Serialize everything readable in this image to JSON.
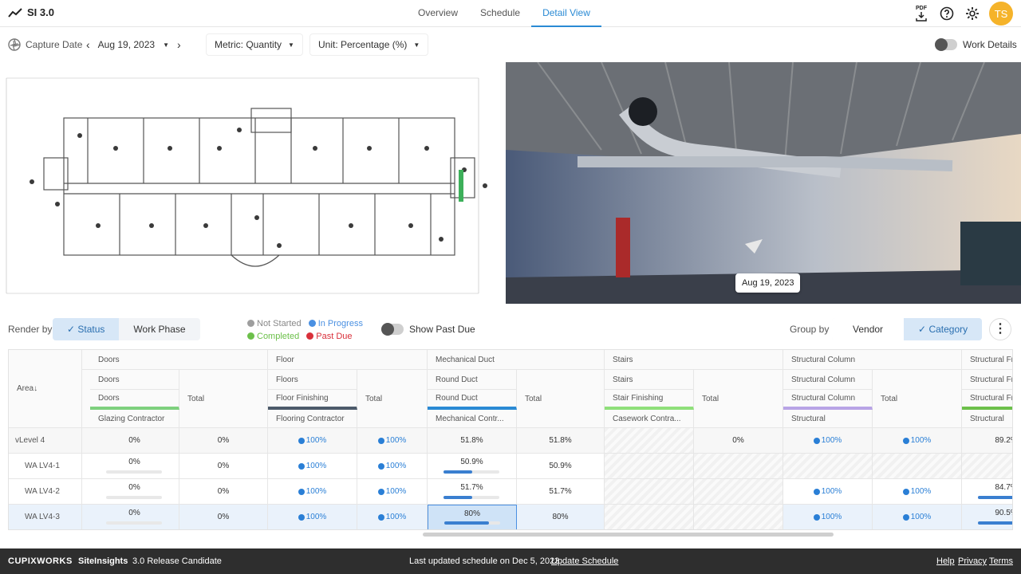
{
  "app": {
    "title": "SI 3.0"
  },
  "nav": {
    "tabs": [
      "Overview",
      "Schedule",
      "Detail View"
    ]
  },
  "header": {
    "pdf_label": "PDF",
    "user_initials": "TS"
  },
  "filters": {
    "capture_label": "Capture Date",
    "date": "Aug 19, 2023",
    "metric": "Metric: Quantity",
    "unit": "Unit: Percentage (%)",
    "work_details": "Work Details"
  },
  "viewer": {
    "date_label": "Aug 19, 2023"
  },
  "render": {
    "label": "Render by",
    "status": "Status",
    "work_phase": "Work Phase",
    "show_past_due": "Show Past Due",
    "group_by": "Group by",
    "vendor": "Vendor",
    "category": "Category"
  },
  "legend": {
    "not_started": "Not Started",
    "in_progress": "In Progress",
    "completed": "Completed",
    "past_due": "Past Due"
  },
  "colors": {
    "accent": "#2a8ad4",
    "not_started": "#9e9e9e",
    "in_progress": "#4a90e2",
    "completed": "#6cc04a",
    "past_due": "#d9303a",
    "avatar": "#f5b32a"
  },
  "table": {
    "area_header": "Area",
    "groups": [
      {
        "name": "Doors",
        "sub1": "Doors",
        "sub2": "Doors",
        "contractor": "Glazing Contractor",
        "bar": "#7ed07e"
      },
      {
        "name": "Floor",
        "sub1": "Floors",
        "sub2": "Floor Finishing",
        "contractor": "Flooring Contractor",
        "bar": "#4c5a6a"
      },
      {
        "name": "Mechanical Duct",
        "sub1": "Round Duct",
        "sub2": "Round Duct",
        "contractor": "Mechanical Contr...",
        "bar": "#2a8ad4"
      },
      {
        "name": "Stairs",
        "sub1": "Stairs",
        "sub2": "Stair Finishing",
        "contractor": "Casework Contra...",
        "bar": "#8fe07a"
      },
      {
        "name": "Structural Column",
        "sub1": "Structural Column",
        "sub2": "Structural Column",
        "contractor": "Structural",
        "bar": "#b8a4e6"
      },
      {
        "name": "Structural Fra",
        "sub1": "Structural Fra",
        "sub2": "Structural Fra",
        "contractor": "Structural",
        "bar": "#6cc04a"
      }
    ],
    "total_label": "Total",
    "rows": [
      {
        "area": "Level 4",
        "cells": [
          "0%",
          "0%",
          "100%",
          "100%",
          "51.8%",
          "51.8%",
          "",
          "0%",
          "100%",
          "100%",
          "89.2%"
        ]
      },
      {
        "area": "WA LV4-1",
        "cells": [
          "0%",
          "0%",
          "100%",
          "100%",
          "50.9%",
          "50.9%",
          "",
          "",
          "",
          "",
          "",
          ""
        ]
      },
      {
        "area": "WA LV4-2",
        "cells": [
          "0%",
          "0%",
          "100%",
          "100%",
          "51.7%",
          "51.7%",
          "",
          "",
          "100%",
          "100%",
          "84.7%"
        ]
      },
      {
        "area": "WA LV4-3",
        "cells": [
          "0%",
          "0%",
          "100%",
          "100%",
          "80%",
          "80%",
          "",
          "",
          "100%",
          "100%",
          "90.5%"
        ]
      }
    ]
  },
  "footer": {
    "brand": "CUPIXWORKS",
    "product": "SiteInsights",
    "release": "3.0 Release Candidate",
    "updated": "Last updated schedule on Dec 5, 2023.",
    "update_link": "Update Schedule",
    "help": "Help",
    "privacy": "Privacy",
    "terms": "Terms"
  }
}
